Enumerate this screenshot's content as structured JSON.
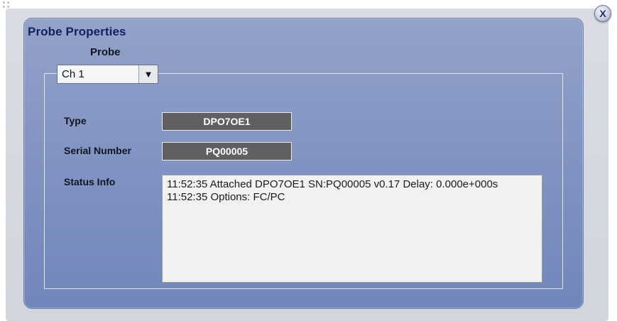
{
  "dialog": {
    "title": "Probe Properties",
    "close_label": "X"
  },
  "probe": {
    "label": "Probe",
    "selected": "Ch 1",
    "arrow": "▼"
  },
  "fields": {
    "type_label": "Type",
    "type_value": "DPO7OE1",
    "serial_label": "Serial Number",
    "serial_value": "PQ00005",
    "status_label": "Status Info"
  },
  "status_lines": [
    "11:52:35 Attached DPO7OE1 SN:PQ00005 v0.17 Delay: 0.000e+000s",
    "11:52:35 Options: FC/PC"
  ]
}
